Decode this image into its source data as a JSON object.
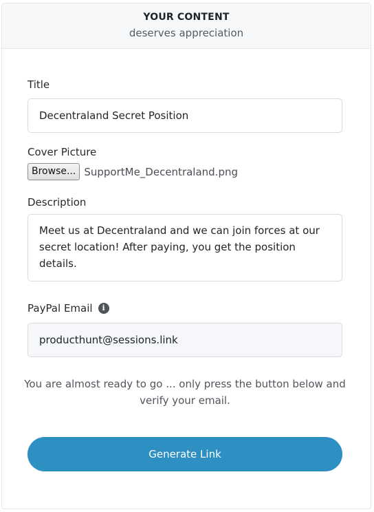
{
  "header": {
    "title": "YOUR CONTENT",
    "subtitle": "deserves appreciation"
  },
  "form": {
    "title_label": "Title",
    "title_value": "Decentraland Secret Position",
    "cover_label": "Cover Picture",
    "browse_label": "Browse...",
    "cover_file": "SupportMe_Decentraland.png",
    "description_label": "Description",
    "description_value": "Meet us at Decentraland and we can join forces at our secret location! After paying, you get the position details.",
    "paypal_label": "PayPal Email",
    "paypal_info_icon": "info-circle-icon",
    "paypal_value": "producthunt@sessions.link"
  },
  "hint": "You are almost ready to go ... only press the button below and verify your email.",
  "generate_label": "Generate Link",
  "colors": {
    "accent": "#2d8fc2",
    "header_bg": "#f7f8fa",
    "input_filled_bg": "#f5f7fa"
  }
}
